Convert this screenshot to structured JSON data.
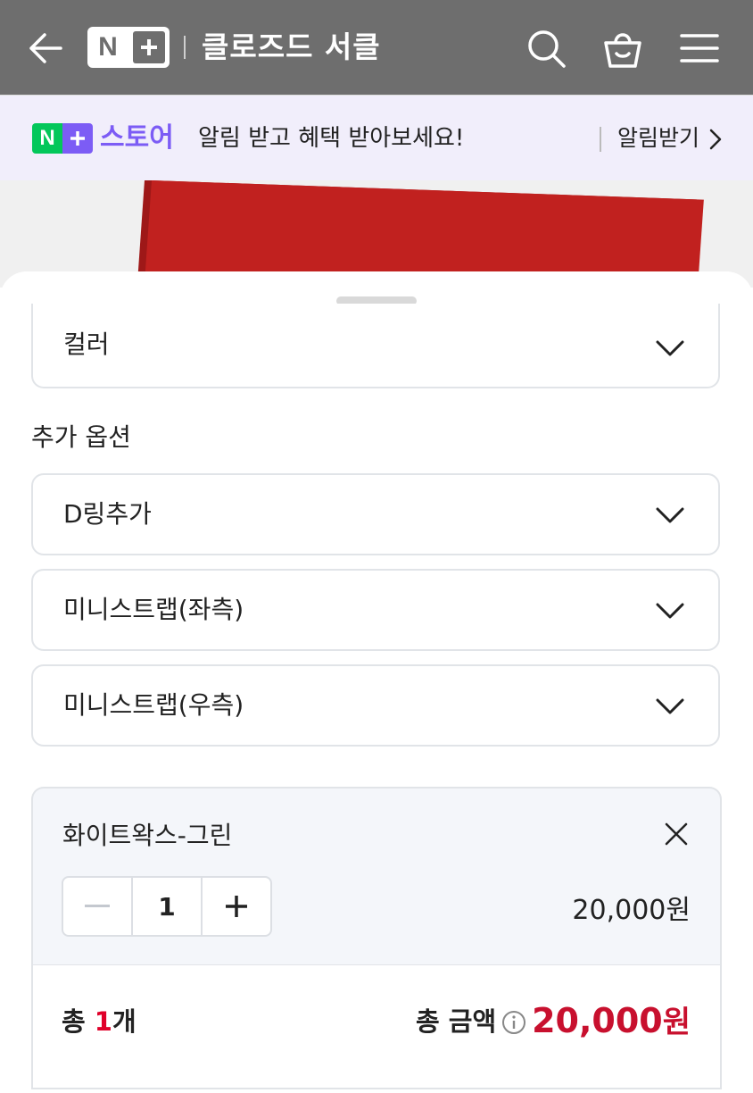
{
  "header": {
    "logo_text": "N",
    "store_name": "클로즈드 서클"
  },
  "banner": {
    "logo_text": "N",
    "store_label": "스토어",
    "message": "알림 받고 혜택 받아보세요!",
    "link_label": "알림받기"
  },
  "options": {
    "color_select": "컬러",
    "additional_title": "추가 옵션",
    "additional": [
      {
        "label": "D링추가"
      },
      {
        "label": "미니스트랩(좌측)"
      },
      {
        "label": "미니스트랩(우측)"
      }
    ]
  },
  "selected_item": {
    "name": "화이트왁스-그린",
    "quantity": "1",
    "price": "20,000원"
  },
  "summary": {
    "count_prefix": "총 ",
    "count_value": "1",
    "count_suffix": "개",
    "amount_label": "총 금액",
    "amount_value": "20,000",
    "amount_unit": "원"
  },
  "colors": {
    "header_bg": "#6e6e6e",
    "banner_bg": "#f1eefb",
    "naver_green": "#03c75a",
    "naver_purple": "#7c5cf5",
    "price_red": "#c8102e"
  }
}
